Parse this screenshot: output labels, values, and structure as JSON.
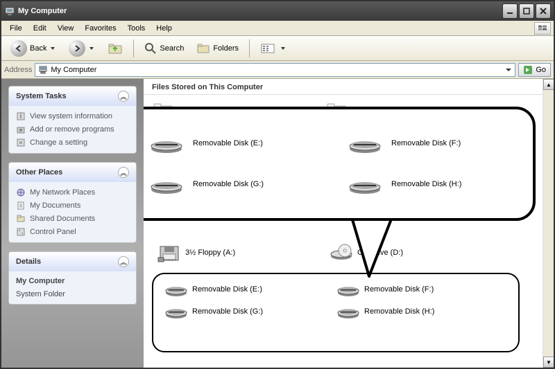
{
  "titlebar": {
    "title": "My Computer"
  },
  "menubar": {
    "items": [
      "File",
      "Edit",
      "View",
      "Favorites",
      "Tools",
      "Help"
    ]
  },
  "toolbar": {
    "back": "Back",
    "search": "Search",
    "folders": "Folders"
  },
  "addressbar": {
    "label": "Address",
    "value": "My Computer",
    "go": "Go"
  },
  "sidebar": {
    "systemTasks": {
      "title": "System Tasks",
      "items": [
        "View system information",
        "Add or remove programs",
        "Change a setting"
      ]
    },
    "otherPlaces": {
      "title": "Other Places",
      "items": [
        "My Network Places",
        "My Documents",
        "Shared Documents",
        "Control Panel"
      ]
    },
    "details": {
      "title": "Details",
      "name": "My Computer",
      "type": "System Folder"
    }
  },
  "main": {
    "sectionHeader": "Files Stored on This Computer",
    "floppy": "3½ Floppy (A:)",
    "cdrom": "CD Drive (D:)",
    "removable": [
      "Removable Disk (E:)",
      "Removable Disk (F:)",
      "Removable Disk (G:)",
      "Removable Disk (H:)"
    ]
  }
}
